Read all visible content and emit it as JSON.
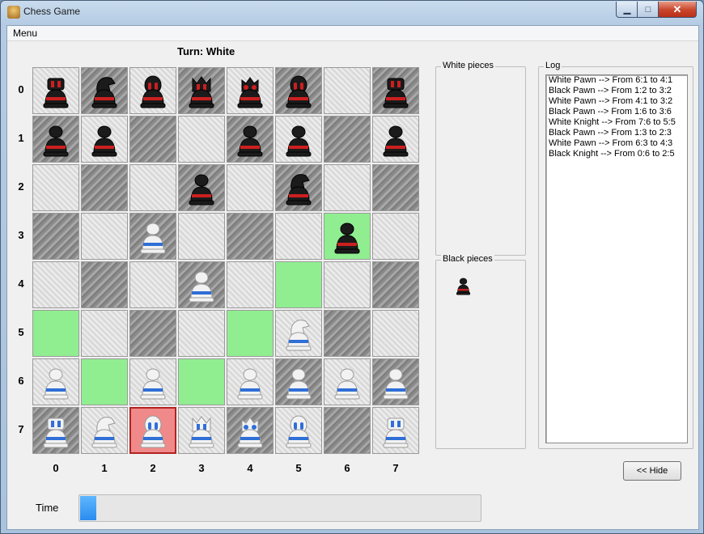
{
  "window": {
    "title": "Chess Game"
  },
  "menu": {
    "label": "Menu"
  },
  "turn_text": "Turn: White",
  "board": {
    "row_labels": [
      "0",
      "1",
      "2",
      "3",
      "4",
      "5",
      "6",
      "7"
    ],
    "col_labels": [
      "0",
      "1",
      "2",
      "3",
      "4",
      "5",
      "6",
      "7"
    ],
    "highlight_cells": {
      "valid_moves": [
        "3,6",
        "4,5",
        "5,0",
        "5,4",
        "6,1",
        "6,3"
      ],
      "selected": [
        "7,2"
      ]
    },
    "pieces": [
      {
        "row": 0,
        "col": 0,
        "color": "black",
        "type": "rook"
      },
      {
        "row": 0,
        "col": 1,
        "color": "black",
        "type": "knight"
      },
      {
        "row": 0,
        "col": 2,
        "color": "black",
        "type": "bishop"
      },
      {
        "row": 0,
        "col": 3,
        "color": "black",
        "type": "queen"
      },
      {
        "row": 0,
        "col": 4,
        "color": "black",
        "type": "king"
      },
      {
        "row": 0,
        "col": 5,
        "color": "black",
        "type": "bishop"
      },
      {
        "row": 0,
        "col": 7,
        "color": "black",
        "type": "rook"
      },
      {
        "row": 1,
        "col": 0,
        "color": "black",
        "type": "pawn"
      },
      {
        "row": 1,
        "col": 1,
        "color": "black",
        "type": "pawn"
      },
      {
        "row": 1,
        "col": 4,
        "color": "black",
        "type": "pawn"
      },
      {
        "row": 1,
        "col": 5,
        "color": "black",
        "type": "pawn"
      },
      {
        "row": 1,
        "col": 7,
        "color": "black",
        "type": "pawn"
      },
      {
        "row": 2,
        "col": 3,
        "color": "black",
        "type": "pawn"
      },
      {
        "row": 2,
        "col": 5,
        "color": "black",
        "type": "knight"
      },
      {
        "row": 3,
        "col": 2,
        "color": "white",
        "type": "pawn"
      },
      {
        "row": 3,
        "col": 6,
        "color": "black",
        "type": "pawn"
      },
      {
        "row": 4,
        "col": 3,
        "color": "white",
        "type": "pawn"
      },
      {
        "row": 5,
        "col": 5,
        "color": "white",
        "type": "knight"
      },
      {
        "row": 6,
        "col": 0,
        "color": "white",
        "type": "pawn"
      },
      {
        "row": 6,
        "col": 2,
        "color": "white",
        "type": "pawn"
      },
      {
        "row": 6,
        "col": 4,
        "color": "white",
        "type": "pawn"
      },
      {
        "row": 6,
        "col": 5,
        "color": "white",
        "type": "pawn"
      },
      {
        "row": 6,
        "col": 6,
        "color": "white",
        "type": "pawn"
      },
      {
        "row": 6,
        "col": 7,
        "color": "white",
        "type": "pawn"
      },
      {
        "row": 7,
        "col": 0,
        "color": "white",
        "type": "rook"
      },
      {
        "row": 7,
        "col": 1,
        "color": "white",
        "type": "knight"
      },
      {
        "row": 7,
        "col": 2,
        "color": "white",
        "type": "bishop"
      },
      {
        "row": 7,
        "col": 3,
        "color": "white",
        "type": "queen"
      },
      {
        "row": 7,
        "col": 4,
        "color": "white",
        "type": "king"
      },
      {
        "row": 7,
        "col": 5,
        "color": "white",
        "type": "bishop"
      },
      {
        "row": 7,
        "col": 7,
        "color": "white",
        "type": "rook"
      }
    ]
  },
  "panels": {
    "white_pieces_label": "White pieces",
    "black_pieces_label": "Black pieces",
    "captured_black": [
      {
        "type": "pawn"
      }
    ],
    "log_label": "Log"
  },
  "log": [
    "White Pawn --> From 6:1 to 4:1",
    "Black Pawn --> From 1:2 to 3:2",
    "White Pawn --> From 4:1 to 3:2",
    "Black Pawn --> From 1:6 to 3:6",
    "White Knight --> From 7:6 to 5:5",
    "Black Pawn --> From 1:3 to 2:3",
    "White Pawn --> From 6:3 to 4:3",
    "Black Knight --> From 0:6 to 2:5"
  ],
  "hide_button": "<< Hide",
  "time": {
    "label": "Time",
    "progress": 0.04
  },
  "colors": {
    "valid_move": "#90ee90",
    "selected": "#f08a8a",
    "black_accent": "#cc1f1f",
    "white_accent": "#2f6fd6"
  }
}
